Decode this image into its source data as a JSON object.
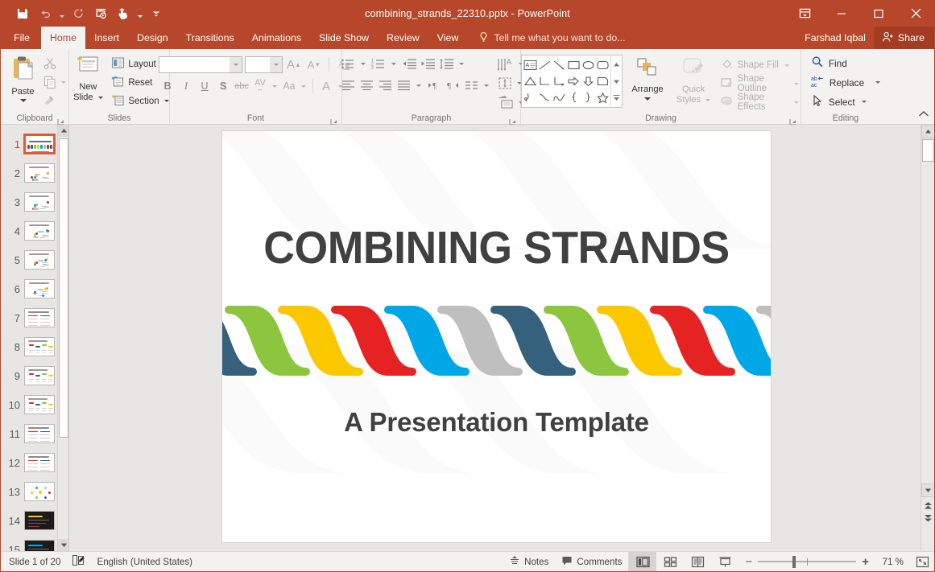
{
  "window": {
    "title": "combining_strands_22310.pptx - PowerPoint",
    "quick_access": [
      {
        "name": "save",
        "icon": "save-icon"
      },
      {
        "name": "undo",
        "icon": "undo-icon"
      },
      {
        "name": "redo",
        "icon": "redo-icon"
      },
      {
        "name": "start-from-beginning",
        "icon": "presentation-icon"
      },
      {
        "name": "touch-mouse-mode",
        "icon": "touch-mode-icon"
      },
      {
        "name": "customize-quick-access-toolbar",
        "icon": "customize-icon"
      }
    ],
    "controls": [
      {
        "name": "ribbon-display-options",
        "icon": "ribbon-options-icon"
      },
      {
        "name": "minimize",
        "icon": "minimize-icon"
      },
      {
        "name": "maximize",
        "icon": "maximize-icon"
      },
      {
        "name": "close",
        "icon": "close-icon"
      }
    ]
  },
  "ribbon": {
    "tabs": [
      {
        "label": "File",
        "active": false
      },
      {
        "label": "Home",
        "active": true
      },
      {
        "label": "Insert",
        "active": false
      },
      {
        "label": "Design",
        "active": false
      },
      {
        "label": "Transitions",
        "active": false
      },
      {
        "label": "Animations",
        "active": false
      },
      {
        "label": "Slide Show",
        "active": false
      },
      {
        "label": "Review",
        "active": false
      },
      {
        "label": "View",
        "active": false
      }
    ],
    "tell_me": "Tell me what you want to do...",
    "user_name": "Farshad Iqbal",
    "share_label": "Share",
    "groups": {
      "clipboard": {
        "label": "Clipboard",
        "paste_label": "Paste",
        "cut_label": "Cut",
        "copy_label": "Copy",
        "format_painter_label": "Format Painter"
      },
      "slides": {
        "label": "Slides",
        "new_slide_line1": "New",
        "new_slide_line2": "Slide",
        "layout_label": "Layout",
        "reset_label": "Reset",
        "section_label": "Section"
      },
      "font": {
        "label": "Font",
        "font_name_value": "",
        "font_size_value": "",
        "bold": "B",
        "italic": "I",
        "underline": "U",
        "shadow": "S",
        "strikethrough": "abc",
        "character_spacing": "AV",
        "change_case": "Aa",
        "font_color": "A"
      },
      "paragraph": {
        "label": "Paragraph"
      },
      "drawing": {
        "label": "Drawing",
        "arrange_label": "Arrange",
        "quick_styles_line1": "Quick",
        "quick_styles_line2": "Styles",
        "shape_fill_label": "Shape Fill",
        "shape_outline_label": "Shape Outline",
        "shape_effects_label": "Shape Effects"
      },
      "editing": {
        "label": "Editing",
        "find_label": "Find",
        "replace_label": "Replace",
        "select_label": "Select"
      }
    }
  },
  "thumbnails": {
    "active_index": 1,
    "items": [
      {
        "number": "1",
        "style": "title"
      },
      {
        "number": "2",
        "style": "diagram-a"
      },
      {
        "number": "3",
        "style": "diagram-b"
      },
      {
        "number": "4",
        "style": "diagram-c"
      },
      {
        "number": "5",
        "style": "diagram-d"
      },
      {
        "number": "6",
        "style": "diagram-e"
      },
      {
        "number": "7",
        "style": "text-grid"
      },
      {
        "number": "8",
        "style": "chart-a"
      },
      {
        "number": "9",
        "style": "chart-b"
      },
      {
        "number": "10",
        "style": "chart-c"
      },
      {
        "number": "11",
        "style": "text-list"
      },
      {
        "number": "12",
        "style": "text-cols"
      },
      {
        "number": "13",
        "style": "radial"
      },
      {
        "number": "14",
        "style": "dark-a"
      },
      {
        "number": "15",
        "style": "dark-b"
      }
    ]
  },
  "slide": {
    "title": "COMBINING STRANDS",
    "subtitle": "A Presentation Template",
    "title_color": "#404040",
    "background": "#ffffff",
    "strand_colors": [
      "#bfbfbf",
      "#35617d",
      "#8cc63e",
      "#fbc800",
      "#e52322",
      "#00a7e7"
    ]
  },
  "status_bar": {
    "slide_indicator": "Slide 1 of 20",
    "language": "English (United States)",
    "notes_label": "Notes",
    "comments_label": "Comments",
    "views": [
      {
        "name": "normal-view",
        "active": true
      },
      {
        "name": "slide-sorter-view",
        "active": false
      },
      {
        "name": "reading-view",
        "active": false
      },
      {
        "name": "slide-show-view",
        "active": false
      }
    ],
    "zoom_percent": "71 %",
    "zoom_out": "−",
    "zoom_in": "+"
  }
}
